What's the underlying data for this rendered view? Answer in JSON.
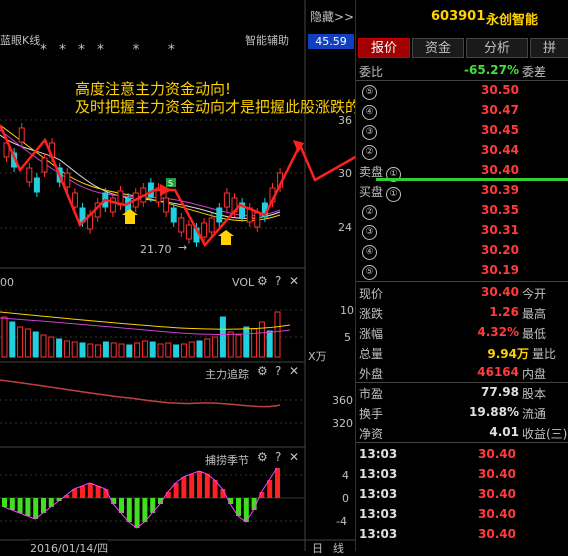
{
  "chart": {
    "hide_label": "隐藏>>",
    "kline_label": "蓝眼K线",
    "assist_label": "智能辅助",
    "price_badge": "45.59",
    "annotation_line1": "高度注意主力资金动向!",
    "annotation_line2": "及时把握主力资金动向才是把握此股涨跌的关键!",
    "low_price": "21.70",
    "price_axis": [
      "36",
      "30",
      "24"
    ],
    "vol_panel": {
      "title": "VOL",
      "axis": [
        "10",
        "5"
      ],
      "unit": "X万",
      "left_label": "00"
    },
    "flow_panel": {
      "title": "主力追踪",
      "axis": [
        "360",
        "320"
      ]
    },
    "season_panel": {
      "title": "捕捞季节",
      "axis": [
        "4",
        "0",
        "-4"
      ]
    },
    "date_label": "2016/01/14/四",
    "bottom_tabs": [
      "日",
      "线"
    ],
    "icons": {
      "gear": "⚙",
      "help": "?",
      "close": "✕"
    }
  },
  "quote": {
    "code": "603901",
    "name": "永创智能",
    "tabs": [
      "报价",
      "资金",
      "分析",
      "拼"
    ],
    "weibi_label": "委比",
    "weibi_value": "-65.27%",
    "weicha_label": "委差",
    "sell_label": "卖盘",
    "buy_label": "买盘",
    "asks": [
      {
        "level": "⑤",
        "price": "30.50"
      },
      {
        "level": "④",
        "price": "30.47"
      },
      {
        "level": "③",
        "price": "30.45"
      },
      {
        "level": "②",
        "price": "30.44"
      },
      {
        "level": "①",
        "price": "30.40"
      }
    ],
    "bids": [
      {
        "level": "①",
        "price": "30.39"
      },
      {
        "level": "②",
        "price": "30.35"
      },
      {
        "level": "③",
        "price": "30.31"
      },
      {
        "level": "④",
        "price": "30.20"
      },
      {
        "level": "⑤",
        "price": "30.19"
      }
    ],
    "stats": [
      {
        "label": "现价",
        "value": "30.40",
        "label2": "今开",
        "color": "red"
      },
      {
        "label": "涨跌",
        "value": "1.26",
        "label2": "最高",
        "color": "red"
      },
      {
        "label": "涨幅",
        "value": "4.32%",
        "label2": "最低",
        "color": "red"
      },
      {
        "label": "总量",
        "value": "9.94万",
        "label2": "量比",
        "color": "yellow"
      },
      {
        "label": "外盘",
        "value": "46164",
        "label2": "内盘",
        "color": "red"
      }
    ],
    "stats2": [
      {
        "label": "市盈",
        "value": "77.98",
        "label2": "股本"
      },
      {
        "label": "换手",
        "value": "19.88%",
        "label2": "流通"
      },
      {
        "label": "净资",
        "value": "4.01",
        "label2": "收益(三)"
      }
    ],
    "trades": [
      {
        "time": "13:03",
        "price": "30.40"
      },
      {
        "time": "13:03",
        "price": "30.40"
      },
      {
        "time": "13:03",
        "price": "30.40"
      },
      {
        "time": "13:03",
        "price": "30.40"
      },
      {
        "time": "13:03",
        "price": "30.40"
      }
    ],
    "colors": {
      "red": "#ff3b3b",
      "green": "#40e040",
      "yellow": "#ffd200"
    }
  }
}
